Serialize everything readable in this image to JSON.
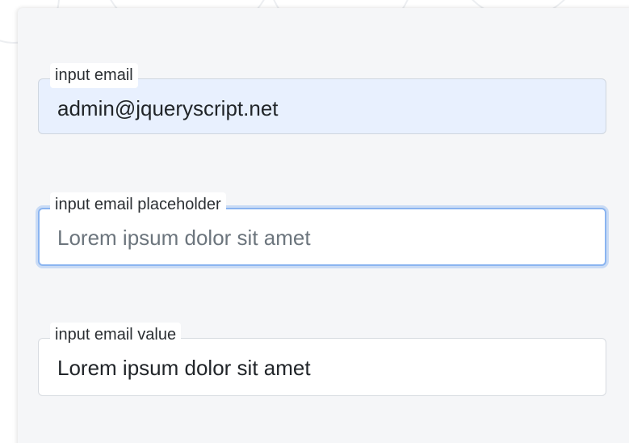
{
  "form": {
    "fields": [
      {
        "label": "input email",
        "value": "admin@jqueryscript.net",
        "placeholder": "",
        "state": "autofilled"
      },
      {
        "label": "input email placeholder",
        "value": "",
        "placeholder": "Lorem ipsum dolor sit amet",
        "state": "focused"
      },
      {
        "label": "input email value",
        "value": "Lorem ipsum dolor sit amet",
        "placeholder": "",
        "state": "default"
      }
    ]
  },
  "colors": {
    "autofill_background": "#e8f0fe",
    "focus_ring": "#8ab4f0",
    "card_background": "#f5f6f8",
    "placeholder_text": "#6c757d"
  }
}
